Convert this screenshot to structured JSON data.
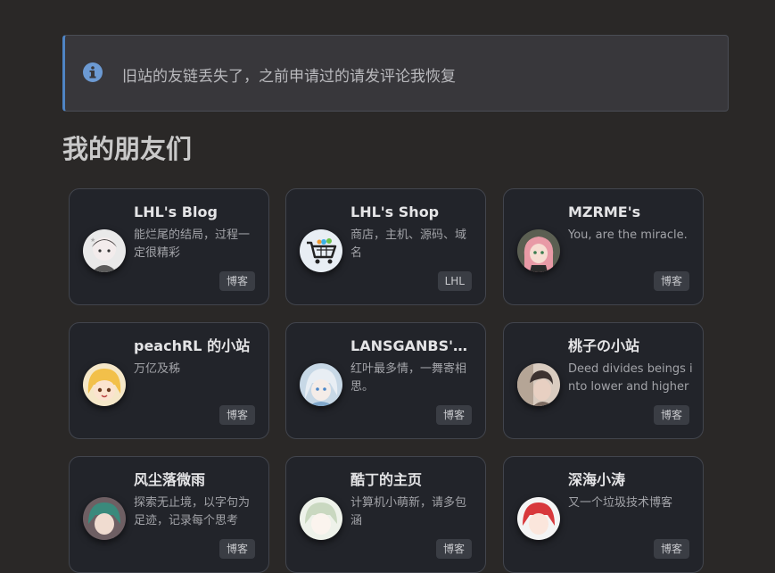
{
  "notice": {
    "text": "旧站的友链丢失了，之前申请过的请发评论我恢复",
    "icon": "info-circle-icon",
    "accent": "#4f84c4"
  },
  "section": {
    "title": "我的朋友们"
  },
  "friends": [
    {
      "name": "LHL's Blog",
      "desc": "能烂尾的结局，过程一定很精彩",
      "tag": "博客"
    },
    {
      "name": "LHL's Shop",
      "desc": "商店，主机、源码、域名",
      "tag": "LHL"
    },
    {
      "name": "MZRME's",
      "desc": "You, are the miracle.",
      "tag": "博客"
    },
    {
      "name": "peachRL 的小站",
      "desc": "万亿及秭",
      "tag": "博客"
    },
    {
      "name": "LANSGANBS's Blog",
      "desc": "红叶最多情，一舞寄相思。",
      "tag": "博客"
    },
    {
      "name": "桃子の小站",
      "desc": "Deed divides beings into lower and higher ones.",
      "tag": "博客"
    },
    {
      "name": "风尘落微雨",
      "desc": "探索无止境，以字句为足迹，记录每个思考",
      "tag": "博客"
    },
    {
      "name": "酷丁的主页",
      "desc": "计算机小萌新，请多包涵",
      "tag": "博客"
    },
    {
      "name": "深海小涛",
      "desc": "又一个垃圾技术博客",
      "tag": "博客"
    }
  ]
}
